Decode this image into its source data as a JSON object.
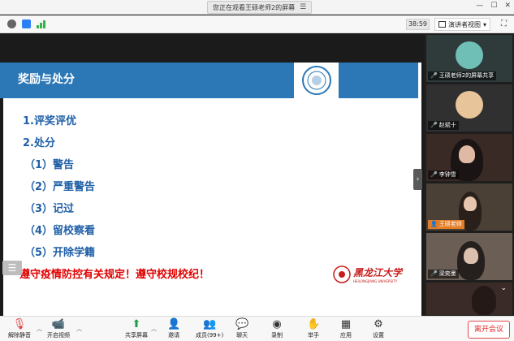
{
  "titlebar": {
    "share_banner": "您正在观看王硕老师2的屏幕",
    "menu_glyph": "☰",
    "win_min": "—",
    "win_max": "☐",
    "win_close": "✕"
  },
  "toolbar": {
    "timer": "38:59",
    "view_label": "演讲者视图",
    "view_caret": "▾",
    "fullscreen_glyph": "⛶"
  },
  "slide": {
    "title": "奖励与处分",
    "items": [
      "1.评奖评优",
      "2.处分",
      "（1）警告",
      "（2）严重警告",
      "（3）记过",
      "（4）留校察看",
      "（5）开除学籍"
    ],
    "warning": "遵守疫情防控有关规定！遵守校规校纪！",
    "university_cn": "黑龙江大学",
    "university_en": "HEILONGJIANG UNIVERSITY"
  },
  "gallery": {
    "tiles": [
      {
        "name": "王硕老师2的屏幕共享"
      },
      {
        "name": "赵斌十"
      },
      {
        "name": "李钟雪"
      },
      {
        "name": "王硕老师"
      },
      {
        "name": "梁奕墨"
      },
      {
        "name": ""
      }
    ]
  },
  "bottombar": {
    "mute": "解除静音",
    "video": "开启视频",
    "share": "共享屏幕",
    "invite": "邀请",
    "members": "成员(99+)",
    "chat": "聊天",
    "record": "录制",
    "raise": "举手",
    "apps": "应用",
    "settings": "设置",
    "leave": "离开会议"
  },
  "colors": {
    "slide_blue": "#2c78b7",
    "item_blue": "#1f5fa7",
    "warning_red": "#e00000",
    "leave_red": "#e02b2b"
  }
}
